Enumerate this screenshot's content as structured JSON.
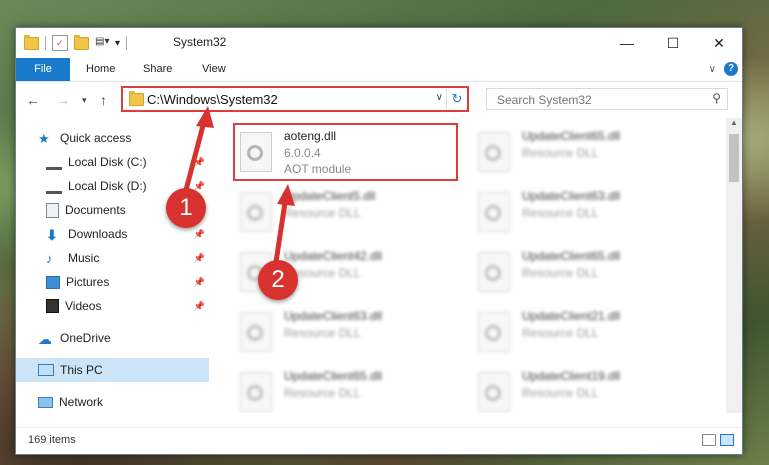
{
  "window": {
    "title": "System32"
  },
  "ribbon": {
    "tabs": [
      "File",
      "Home",
      "Share",
      "View"
    ]
  },
  "nav": {
    "address": "C:\\Windows\\System32",
    "search_placeholder": "Search System32"
  },
  "sidebar": {
    "items": [
      {
        "label": "Quick access",
        "icon": "star-icon"
      },
      {
        "label": "Local Disk (C:)",
        "icon": "drive-icon"
      },
      {
        "label": "Local Disk (D:)",
        "icon": "drive-icon"
      },
      {
        "label": "Documents",
        "icon": "documents-icon"
      },
      {
        "label": "Downloads",
        "icon": "download-icon"
      },
      {
        "label": "Music",
        "icon": "music-icon"
      },
      {
        "label": "Pictures",
        "icon": "pictures-icon"
      },
      {
        "label": "Videos",
        "icon": "videos-icon"
      },
      {
        "label": "OneDrive",
        "icon": "cloud-icon"
      },
      {
        "label": "This PC",
        "icon": "computer-icon"
      },
      {
        "label": "Network",
        "icon": "network-icon"
      }
    ]
  },
  "files": {
    "featured": {
      "name": "aoteng.dll",
      "version": "6.0.0.4",
      "description": "AOT module"
    },
    "left_column": [
      {
        "name": "UpdateClient5.dll",
        "type": "Resource DLL"
      },
      {
        "name": "UpdateClient42.dll",
        "type": "Resource DLL"
      },
      {
        "name": "UpdateClient63.dll",
        "type": "Resource DLL"
      },
      {
        "name": "UpdateClient65.dll",
        "type": "Resource DLL"
      }
    ],
    "right_column": [
      {
        "name": "UpdateClient65.dll",
        "type": "Resource DLL"
      },
      {
        "name": "UpdateClient63.dll",
        "type": "Resource DLL"
      },
      {
        "name": "UpdateClient65.dll",
        "type": "Resource DLL"
      },
      {
        "name": "UpdateClient21.dll",
        "type": "Resource DLL"
      },
      {
        "name": "UpdateClient19.dll",
        "type": "Resource DLL"
      }
    ]
  },
  "status": {
    "item_count": "169 items"
  },
  "annotations": {
    "step1": "1",
    "step2": "2"
  },
  "colors": {
    "accent": "#1979ca",
    "highlight": "#e03c3c",
    "badge": "#d7322f"
  }
}
